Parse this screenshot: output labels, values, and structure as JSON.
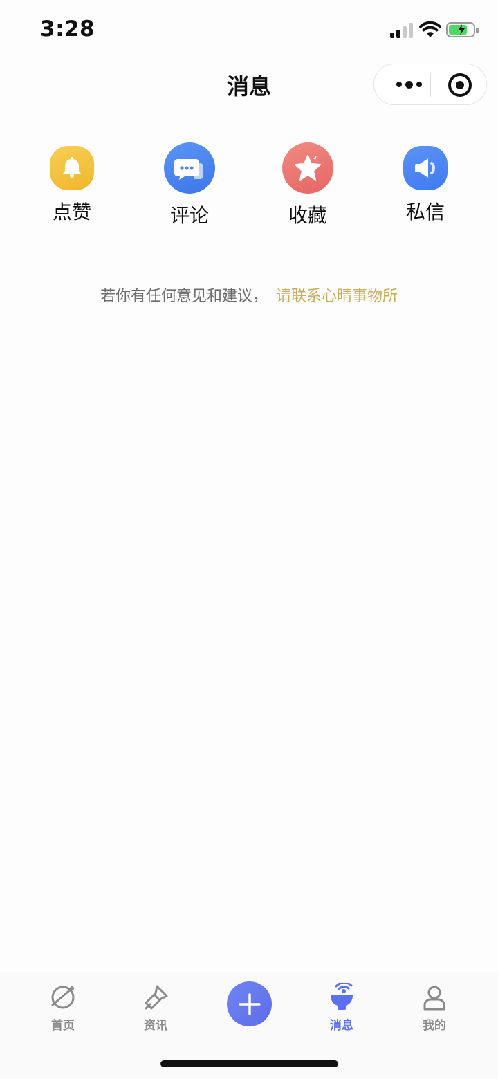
{
  "status_bar": {
    "time": "3:28"
  },
  "nav": {
    "title": "消息"
  },
  "quick_actions": [
    {
      "label": "点赞",
      "icon": "bell-icon",
      "color": "#f3c444"
    },
    {
      "label": "评论",
      "icon": "chat-bubble-icon",
      "color": "#4a86f0"
    },
    {
      "label": "收藏",
      "icon": "star-icon",
      "color": "#ec6f6f"
    },
    {
      "label": "私信",
      "icon": "speaker-icon",
      "color": "#4f88f5"
    }
  ],
  "feedback": {
    "text": "若你有任何意见和建议，",
    "link": "请联系心晴事物所"
  },
  "tabbar": {
    "items": [
      {
        "label": "首页",
        "icon": "planet-icon"
      },
      {
        "label": "资讯",
        "icon": "flashlight-icon"
      },
      {
        "label": "",
        "icon": "plus-icon"
      },
      {
        "label": "消息",
        "icon": "satellite-dish-icon",
        "active": true
      },
      {
        "label": "我的",
        "icon": "user-icon"
      }
    ],
    "active_color": "#5b6ff0",
    "inactive_color": "#8a8a8a"
  }
}
